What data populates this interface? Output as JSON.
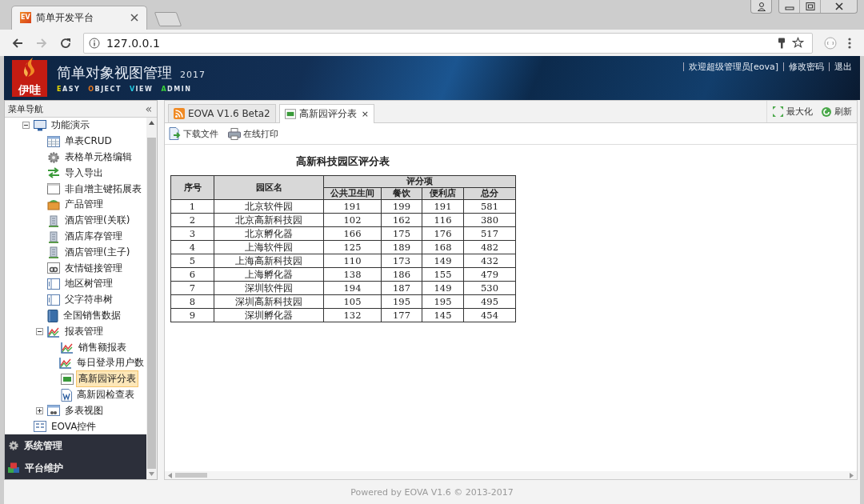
{
  "browser": {
    "tab_title": "简单开发平台",
    "favicon_text": "EV",
    "url": "127.0.0.1"
  },
  "header": {
    "logo_text": "伊哇",
    "title": "简单对象视图管理",
    "year": "2017",
    "tagline": [
      {
        "initial": "E",
        "rest": "ASY",
        "color": "#e8d800"
      },
      {
        "initial": "O",
        "rest": "BJECT",
        "color": "#e8781e"
      },
      {
        "initial": "V",
        "rest": "IEW",
        "color": "#22c8e0"
      },
      {
        "initial": "A",
        "rest": "DMIN",
        "color": "#3ad23a"
      }
    ],
    "links": [
      "欢迎超级管理员[eova]",
      "修改密码",
      "退出"
    ]
  },
  "sidebar": {
    "title": "菜单导航",
    "collapse": "«",
    "tree": [
      {
        "label": "功能演示",
        "expanded": true,
        "selected": false,
        "children": [
          {
            "label": "单表CRUD",
            "selected": false
          },
          {
            "label": "表格单元格编辑",
            "selected": false
          },
          {
            "label": "导入导出",
            "selected": false
          },
          {
            "label": "非自增主键拓展表",
            "selected": false
          },
          {
            "label": "产品管理",
            "selected": false
          },
          {
            "label": "酒店管理(关联)",
            "selected": false
          },
          {
            "label": "酒店库存管理",
            "selected": false
          },
          {
            "label": "酒店管理(主子)",
            "selected": false
          },
          {
            "label": "友情链接管理",
            "selected": false
          },
          {
            "label": "地区树管理",
            "selected": false
          },
          {
            "label": "父字符串树",
            "selected": false
          },
          {
            "label": "全国销售数据",
            "selected": false
          },
          {
            "label": "报表管理",
            "expanded": true,
            "selected": false,
            "children": [
              {
                "label": "销售额报表",
                "selected": false
              },
              {
                "label": "每日登录用户数",
                "selected": false
              },
              {
                "label": "高新园评分表",
                "selected": true
              },
              {
                "label": "高新园检查表",
                "selected": false
              }
            ]
          },
          {
            "label": "多表视图",
            "expanded": false,
            "selected": false
          }
        ]
      },
      {
        "label": "EOVA控件",
        "selected": false
      }
    ],
    "sections": [
      "系统管理",
      "平台维护"
    ]
  },
  "tabs": [
    {
      "label": "EOVA V1.6 Beta2",
      "selected": false
    },
    {
      "label": "高新园评分表",
      "selected": true,
      "close": "×"
    }
  ],
  "tab_actions": [
    "最大化",
    "刷新"
  ],
  "toolbar": [
    "下载文件",
    "在线打印"
  ],
  "report": {
    "title": "高新科技园区评分表",
    "columns": [
      "序号",
      "园区名"
    ],
    "group": "评分项",
    "subcolumns": [
      "公共卫生间",
      "餐饮",
      "便利店",
      "总分"
    ],
    "rows": [
      [
        "1",
        "北京软件园",
        "191",
        "199",
        "191",
        "581"
      ],
      [
        "2",
        "北京高新科技园",
        "102",
        "162",
        "116",
        "380"
      ],
      [
        "3",
        "北京孵化器",
        "166",
        "175",
        "176",
        "517"
      ],
      [
        "4",
        "上海软件园",
        "125",
        "189",
        "168",
        "482"
      ],
      [
        "5",
        "上海高新科技园",
        "110",
        "173",
        "149",
        "432"
      ],
      [
        "6",
        "上海孵化器",
        "138",
        "186",
        "155",
        "479"
      ],
      [
        "7",
        "深圳软件园",
        "194",
        "187",
        "149",
        "530"
      ],
      [
        "8",
        "深圳高新科技园",
        "105",
        "195",
        "195",
        "495"
      ],
      [
        "9",
        "深圳孵化器",
        "132",
        "177",
        "145",
        "454"
      ]
    ]
  },
  "footer": "Powered by EOVA V1.6 © 2013-2017"
}
